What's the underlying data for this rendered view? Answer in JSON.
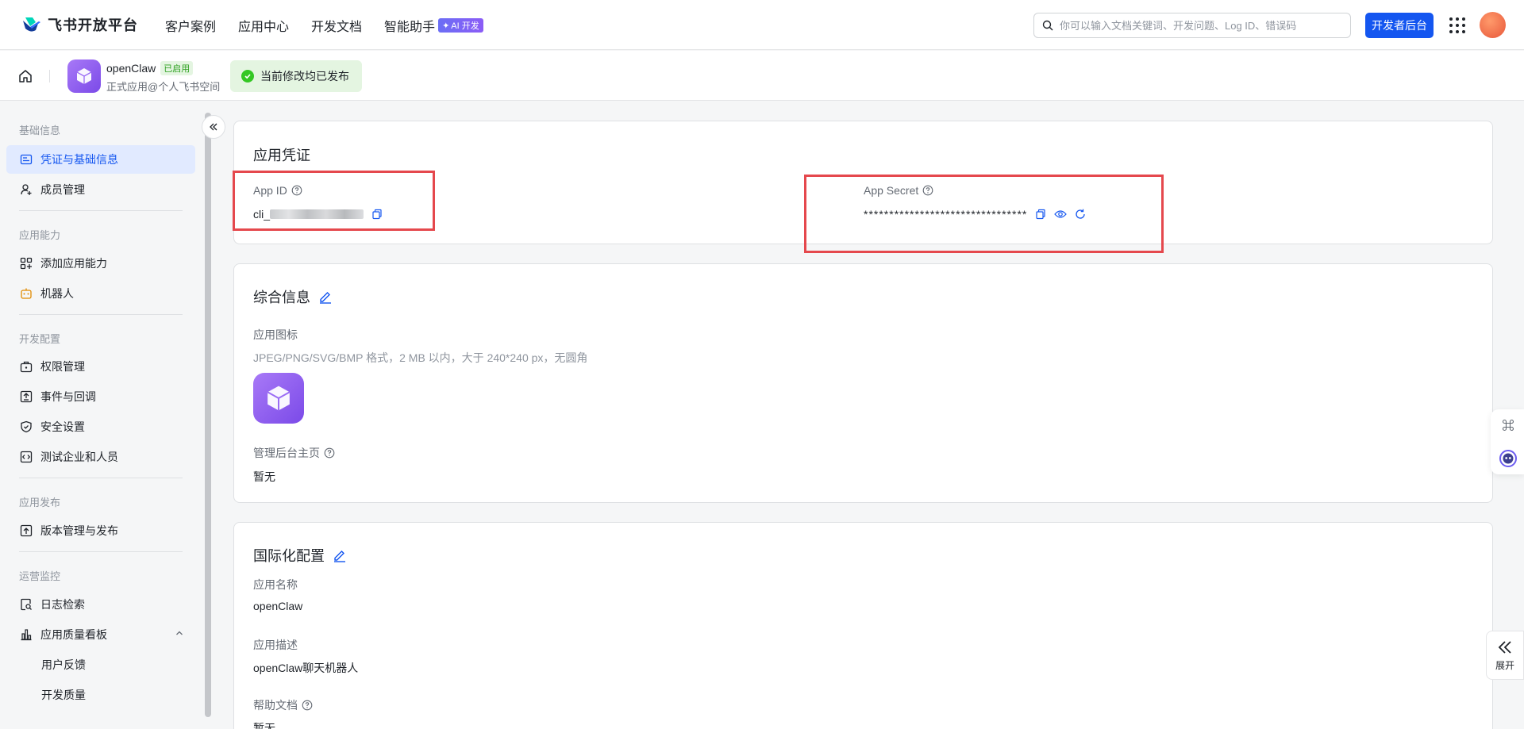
{
  "topnav": {
    "logo_text": "飞书开放平台",
    "links": [
      "客户案例",
      "应用中心",
      "开发文档",
      "智能助手"
    ],
    "ai_badge": "AI 开发",
    "search_placeholder": "你可以输入文档关键词、开发问题、Log ID、错误码",
    "dev_console": "开发者后台"
  },
  "subheader": {
    "app_name": "openClaw",
    "status_badge": "已启用",
    "app_subtitle": "正式应用@个人飞书空间",
    "publish_tip": "当前修改均已发布"
  },
  "sidebar": {
    "sections": [
      {
        "title": "基础信息",
        "items": [
          "凭证与基础信息",
          "成员管理"
        ]
      },
      {
        "title": "应用能力",
        "items": [
          "添加应用能力",
          "机器人"
        ]
      },
      {
        "title": "开发配置",
        "items": [
          "权限管理",
          "事件与回调",
          "安全设置",
          "测试企业和人员"
        ]
      },
      {
        "title": "应用发布",
        "items": [
          "版本管理与发布"
        ]
      },
      {
        "title": "运营监控",
        "items": [
          "日志检索",
          "应用质量看板",
          "用户反馈",
          "开发质量"
        ]
      }
    ],
    "active_item": "凭证与基础信息"
  },
  "credentials": {
    "title": "应用凭证",
    "app_id_label": "App ID",
    "app_id_value": "cli_",
    "app_secret_label": "App Secret",
    "app_secret_value": "********************************"
  },
  "general": {
    "title": "综合信息",
    "icon_label": "应用图标",
    "icon_hint": "JPEG/PNG/SVG/BMP 格式，2 MB 以内，大于 240*240 px，无圆角",
    "homepage_label": "管理后台主页",
    "homepage_value": "暂无"
  },
  "i18n": {
    "title": "国际化配置",
    "name_label": "应用名称",
    "name_value": "openClaw",
    "desc_label": "应用描述",
    "desc_value": "openClaw聊天机器人",
    "help_label": "帮助文档",
    "help_value": "暂无"
  },
  "floating": {
    "expand_label": "展开"
  },
  "colors": {
    "primary": "#1456f0",
    "highlight_box": "#e5484d",
    "success": "#34c724",
    "app_icon": "#8b5cf6"
  }
}
